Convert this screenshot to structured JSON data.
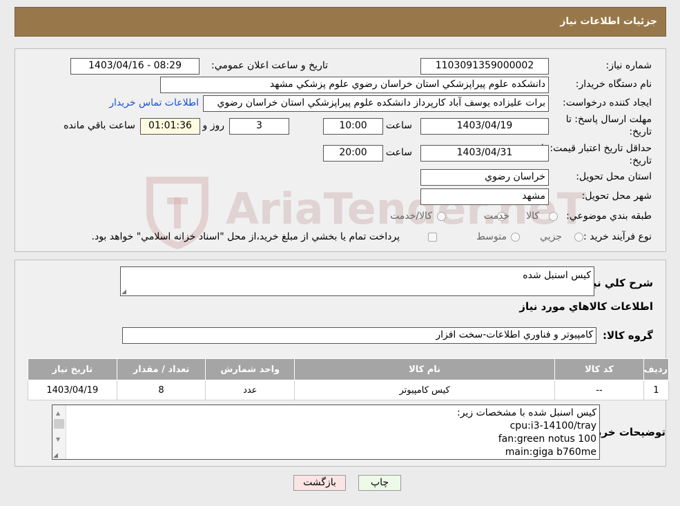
{
  "header": {
    "title": "جزئيات اطلاعات نياز"
  },
  "form": {
    "need_number_label": "شماره نياز:",
    "need_number": "1103091359000002",
    "announce_label": "تاريخ و ساعت اعلان عمومي:",
    "announce_value": "1403/04/16 - 08:29",
    "buyer_label": "نام دستگاه خريدار:",
    "buyer_value": "دانشکده علوم پيراپزشکي استان خراسان رضوي   علوم پزشکي مشهد",
    "creator_label": "ايجاد کننده درخواست:",
    "creator_value": "برات عليزاده يوسف آباد کارپرداز دانشکده علوم پيراپزشکي استان خراسان رضوي",
    "contact_link": "اطلاعات تماس خريدار",
    "deadline_label_1": "مهلت ارسال پاسخ: تا",
    "deadline_label_2": "تاريخ:",
    "deadline_date": "1403/04/19",
    "time_word": "ساعت",
    "deadline_time": "10:00",
    "days_value": "3",
    "days_word": "روز و",
    "remaining_time": "01:01:36",
    "remaining_word": "ساعت باقي مانده",
    "validity_label_1": "حداقل تاريخ اعتبار قيمت: تا",
    "validity_label_2": "تاريخ:",
    "validity_date": "1403/04/31",
    "validity_time": "20:00",
    "province_label": "استان محل تحويل:",
    "province_value": "خراسان رضوي",
    "city_label": "شهر محل تحويل:",
    "city_value": "مشهد",
    "category_label": "طبقه بندي موضوعي:",
    "category_options": [
      "کالا",
      "خدمت",
      "کالا/خدمت"
    ],
    "process_label": "نوع فرآيند خريد :",
    "process_options": [
      "جزيي",
      "متوسط"
    ],
    "payment_note": "پرداخت تمام يا بخشي از مبلغ خريد،از محل \"اسناد خزانه اسلامي\" خواهد بود."
  },
  "details": {
    "summary_label": "شرح کلي نياز:",
    "summary_value": "کيس اسنبل شده",
    "goods_info_title": "اطلاعات کالاهاي مورد نياز",
    "group_label": "گروه کالا:",
    "group_value": "کامپيوتر و فناوري اطلاعات-سخت افزار",
    "table": {
      "headers": [
        "رديف",
        "کد کالا",
        "نام کالا",
        "واحد شمارش",
        "تعداد / مقدار",
        "تاريخ نياز"
      ],
      "rows": [
        [
          "1",
          "--",
          "کيس کامپيوتر",
          "عدد",
          "8",
          "1403/04/19"
        ]
      ]
    },
    "buyer_notes_label": "توضيحات خريدار:",
    "buyer_notes_lines": [
      "کيس اسنبل شده با مشخصات زير:",
      "cpu:i3-14100/tray",
      "fan:green notus 100",
      "main:giga b760me"
    ]
  },
  "buttons": {
    "print": "چاپ",
    "back": "بازگشت"
  },
  "watermark": {
    "text": "AriaTender.neT"
  },
  "colors": {
    "header": "#98784b",
    "table_header": "#a5a5a5",
    "link": "#1a4fd1"
  }
}
